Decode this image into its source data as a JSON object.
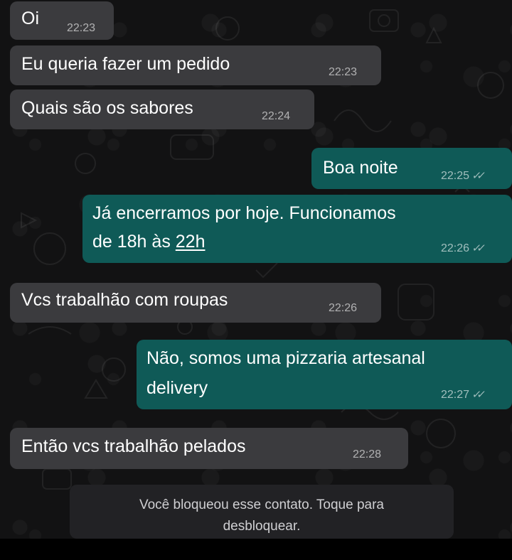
{
  "messages": [
    {
      "text": "Oi",
      "time": "22:23",
      "direction": "incoming"
    },
    {
      "text": "Eu queria fazer um pedido",
      "time": "22:23",
      "direction": "incoming"
    },
    {
      "text": "Quais são os sabores",
      "time": "22:24",
      "direction": "incoming"
    },
    {
      "text": "Boa noite",
      "time": "22:25",
      "direction": "outgoing",
      "status": "read"
    },
    {
      "text_line1": "Já encerramos por hoje. Funcionamos",
      "text_line2a": "de 18h às ",
      "text_line2b": "22h",
      "time": "22:26",
      "direction": "outgoing",
      "status": "read"
    },
    {
      "text": "Vcs trabalhão com roupas",
      "time": "22:26",
      "direction": "incoming"
    },
    {
      "text_line1": "Não, somos uma pizzaria artesanal",
      "text_line2": "delivery",
      "time": "22:27",
      "direction": "outgoing",
      "status": "read"
    },
    {
      "text": "Então vcs trabalhão pelados",
      "time": "22:28",
      "direction": "incoming"
    }
  ],
  "blocked_notice": {
    "line1": "Você bloqueou esse contato. Toque para",
    "line2": "desbloquear."
  },
  "colors": {
    "incoming_bubble": "#3b3b3e",
    "outgoing_bubble": "#0f5a57",
    "chat_background": "#121213"
  },
  "icons": {
    "read_receipt": "double-check-icon"
  }
}
